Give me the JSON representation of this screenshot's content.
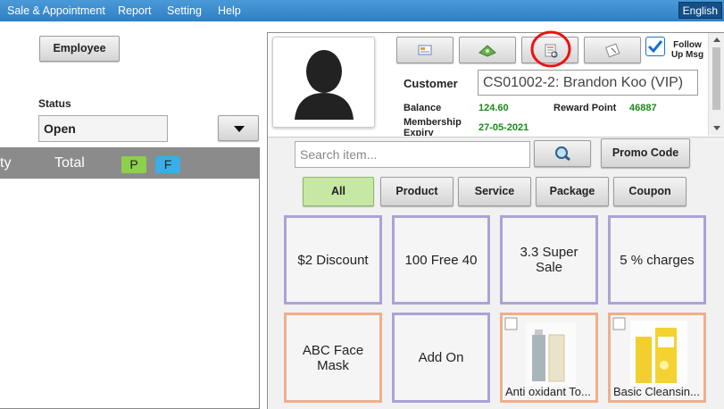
{
  "menu": [
    "Sale & Appointment",
    "Report",
    "Setting",
    "Help"
  ],
  "language": "English",
  "left": {
    "employee_label": "Employee",
    "status_label": "Status",
    "status_value": "Open",
    "grid_headers": {
      "qty_partial": "ty",
      "total": "Total",
      "tag_p": "P",
      "tag_f": "F"
    }
  },
  "customer": {
    "follow_up_label": "Follow Up Msg",
    "follow_up_checked": true,
    "label": "Customer",
    "value": "CS01002-2: Brandon Koo (VIP)",
    "balance_label": "Balance",
    "balance_value": "124.60",
    "reward_label": "Reward Point",
    "reward_value": "46887",
    "membership_label": "Membership Expiry",
    "membership_value": "27-05-2021"
  },
  "search": {
    "placeholder": "Search item...",
    "promo_label": "Promo Code"
  },
  "categories": [
    "All",
    "Product",
    "Service",
    "Package",
    "Coupon"
  ],
  "items": [
    {
      "name": "$2 Discount"
    },
    {
      "name": "100 Free 40"
    },
    {
      "name": "3.3 Super Sale"
    },
    {
      "name": "5 % charges"
    },
    {
      "name": "ABC Face Mask"
    },
    {
      "name": "Add On"
    },
    {
      "name": "Anti oxidant To..."
    },
    {
      "name": "Basic Cleansin..."
    }
  ],
  "colors": {
    "menu_bar": "#3a8bd0",
    "tile_border_purple": "#a9a3d8",
    "tile_border_orange": "#efae8c",
    "value_green": "#1a8a1a",
    "all_active": "#c6e8a4",
    "tag_p": "#8dd04a",
    "tag_f": "#3aaee8"
  }
}
